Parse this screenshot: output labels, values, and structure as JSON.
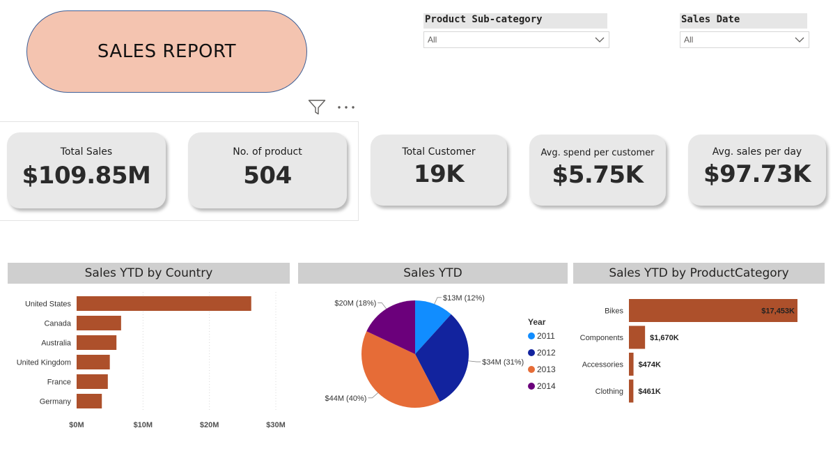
{
  "report_title": "SALES REPORT",
  "slicers": {
    "subcategory": {
      "title": "Product Sub-category",
      "value": "All"
    },
    "sales_date": {
      "title": "Sales Date",
      "value": "All"
    }
  },
  "kpis": {
    "total_sales": {
      "label": "Total Sales",
      "value": "$109.85M"
    },
    "num_products": {
      "label": "No. of product",
      "value": "504"
    },
    "total_customer": {
      "label": "Total Customer",
      "value": "19K"
    },
    "avg_spend": {
      "label": "Avg. spend per customer",
      "value": "$5.75K"
    },
    "avg_sales_day": {
      "label": "Avg. sales per day",
      "value": "$97.73K"
    }
  },
  "colors": {
    "bar": "#ad502b",
    "year_2011": "#118dff",
    "year_2012": "#12239e",
    "year_2013": "#e66c37",
    "year_2014": "#6b007b"
  },
  "chart_data": [
    {
      "type": "bar",
      "orientation": "horizontal",
      "title": "Sales YTD by Country",
      "categories": [
        "United States",
        "Canada",
        "Australia",
        "United Kingdom",
        "France",
        "Germany"
      ],
      "values": [
        26.3,
        6.7,
        6.0,
        5.0,
        4.7,
        3.8
      ],
      "unit": "$M",
      "xlim": [
        0,
        30
      ],
      "x_ticks": [
        "$0M",
        "$10M",
        "$20M",
        "$30M"
      ],
      "x_tick_values": [
        0,
        10,
        20,
        30
      ],
      "grid": true
    },
    {
      "type": "pie",
      "title": "Sales YTD",
      "legend_title": "Year",
      "legend_position": "right",
      "categories": [
        "2011",
        "2012",
        "2013",
        "2014"
      ],
      "values": [
        13,
        34,
        44,
        20
      ],
      "labels": [
        "$13M (12%)",
        "$34M (31%)",
        "$44M (40%)",
        "$20M (18%)"
      ]
    },
    {
      "type": "bar",
      "orientation": "horizontal",
      "title": "Sales YTD by ProductCategory",
      "categories": [
        "Bikes",
        "Components",
        "Accessories",
        "Clothing"
      ],
      "values": [
        17453,
        1670,
        474,
        461
      ],
      "labels": [
        "$17,453K",
        "$1,670K",
        "$474K",
        "$461K"
      ],
      "unit": "$K",
      "grid": false
    }
  ]
}
